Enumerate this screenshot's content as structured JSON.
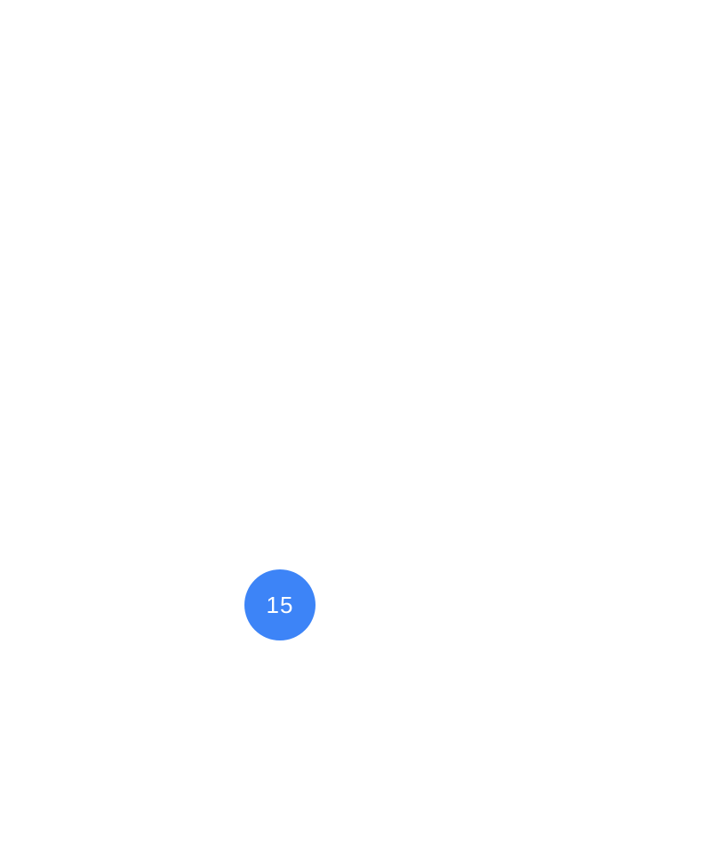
{
  "marker": {
    "count": "15",
    "color": "#3d84f7",
    "text_color": "#ffffff",
    "shape": "circle"
  },
  "background": {
    "color": "#ffffff"
  }
}
